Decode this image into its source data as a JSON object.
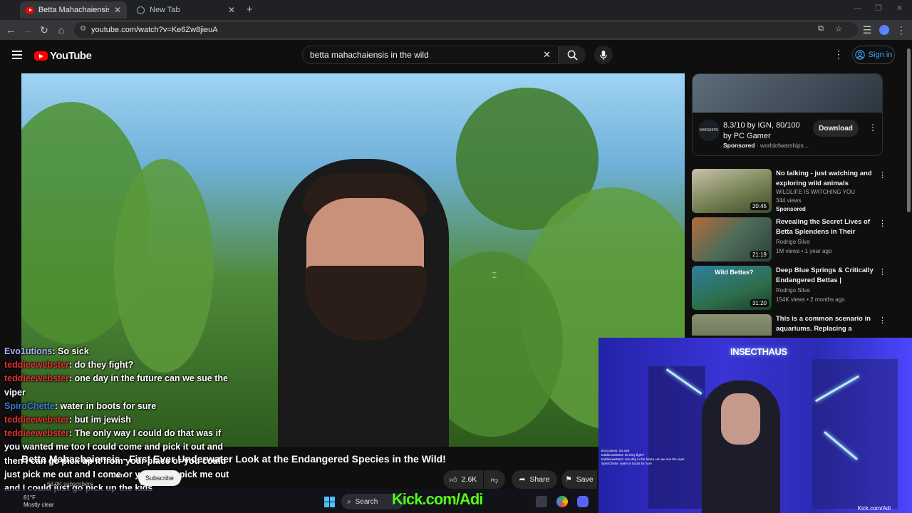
{
  "browser": {
    "tabs": [
      {
        "title": "Betta Mahachaiensis - First Eve",
        "active": true
      },
      {
        "title": "New Tab",
        "active": false
      }
    ],
    "url": "youtube.com/watch?v=Ke6Zw8jieuA"
  },
  "youtube": {
    "logo_text": "YouTube",
    "search_value": "betta mahachaiensis in the wild",
    "signin_label": "Sign in"
  },
  "chat": [
    {
      "user": "Evo1utions",
      "msg": "So sick",
      "color": "#a9b4ff"
    },
    {
      "user": "teddieewebster",
      "msg": "do they fight?",
      "color": "#e03030"
    },
    {
      "user": "teddieewebster",
      "msg": "one day in the future can we sue the viper",
      "color": "#e03030"
    },
    {
      "user": "SpiroChette",
      "msg": "water in boots for sure",
      "color": "#3a7bd5"
    },
    {
      "user": "teddieewebster",
      "msg": "but im jewish",
      "color": "#e03030"
    },
    {
      "user": "teddieewebster",
      "msg": "The only way I could do that was if you wanted me too I could come and pick it out and then I can go pick up it from your place or you could just pick me out and I come or you could pick me out and I could just go pick up the kids",
      "color": "#e03030"
    }
  ],
  "video": {
    "title": "Betta Mahachaiensis - First Ever Underwater Look at the Endangered Species in the Wild!",
    "subscribers": "63.9K subscribers",
    "join_label": "Join",
    "subscribe_label": "Subscribe",
    "likes": "2.6K",
    "share_label": "Share",
    "save_label": "Save"
  },
  "ad": {
    "title": "8.3/10 by IGN, 80/100 by PC Gamer",
    "sponsored": "Sponsored",
    "domain": "worldofwarships...",
    "cta": "Download",
    "logo_text": "WARSHIPS"
  },
  "recommendations": [
    {
      "title": "No talking - just watching and exploring wild animals",
      "channel": "WILDLIFE IS WATCHING YOU",
      "views": "344 views",
      "extra": "Sponsored",
      "duration": "20:45",
      "thumb_color": "#6f7d4f"
    },
    {
      "title": "Revealing the Secret Lives of Betta Splendens in Their Natur...",
      "channel": "Rodrigo Silva",
      "views": "1M views • 1 year ago",
      "extra": "",
      "duration": "21:19",
      "thumb_color": "#4e6b5a"
    },
    {
      "title": "Deep Blue Springs & Critically Endangered Bettas | Exploring ...",
      "channel": "Rodrigo Silva",
      "views": "154K views • 2 months ago",
      "extra": "",
      "duration": "31:20",
      "thumb_color": "#2e7fa0",
      "thumb_text": "Wild Bettas?"
    },
    {
      "title": "This is a common scenario in aquariums. Replacing a plagu...",
      "channel": "",
      "views": "",
      "extra": "",
      "duration": "",
      "thumb_color": "#58614a"
    }
  ],
  "stream_overlay": {
    "brand": "INSECTHAUS",
    "handle": "Kick.com/Adi",
    "kick_banner": "Kick.com/Adi"
  },
  "taskbar": {
    "temp": "81°F",
    "weather": "Mostly clear",
    "search_label": "Search"
  }
}
